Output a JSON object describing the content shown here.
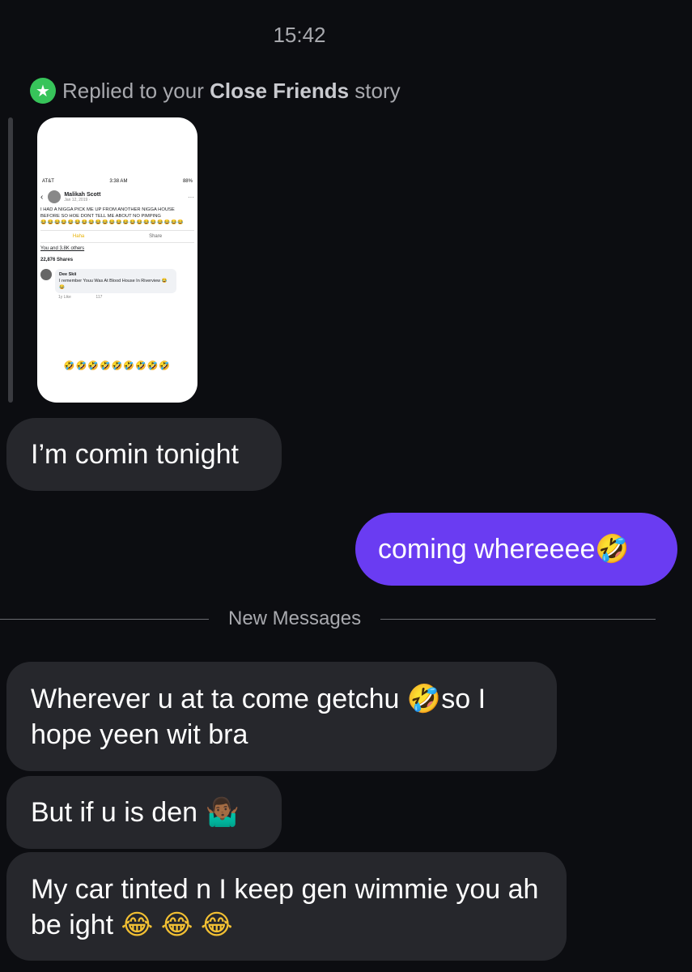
{
  "header": {
    "timestamp": "15:42"
  },
  "story_reply": {
    "prefix": "Replied to your ",
    "highlight": "Close Friends",
    "suffix": " story",
    "icon": "star-icon",
    "badge_color": "#37c45a"
  },
  "story_preview": {
    "status_carrier": "AT&T",
    "status_time": "3:38 AM",
    "status_battery": "88%",
    "author": "Malikah Scott",
    "date": "Jan 12, 2019 · ",
    "post_text": "I HAD A NIGGA PICK ME UP FROM ANOTHER NIGGA HOUSE BEFORE SO HOE DONT TELL ME ABOUT NO PIMPING",
    "post_emojis": "😂😂😂😂😂😂😂😂😂😂😂😂😂😂😂😂😂😂😂😂😂",
    "reaction_label": "Haha",
    "share_label": "Share",
    "reactions": "You and 3.8K others",
    "shares": "22,876 Shares",
    "commenter": "Dee Skii",
    "comment": "I remember Youu Was At Blood House In Riverview 😂😂",
    "comment_meta": "1y    Like",
    "comment_count": "117",
    "overlay_emojis": "🤣🤣🤣🤣🤣🤣🤣🤣🤣"
  },
  "messages": [
    {
      "side": "in",
      "text": "I’m comin tonight"
    },
    {
      "side": "out",
      "text": "coming whereeee",
      "emoji": "🤣"
    },
    {
      "side": "in",
      "text_a": "Wherever u at ta come getchu ",
      "emoji": "🤣",
      "text_b": "so I hope yeen wit bra"
    },
    {
      "side": "in",
      "text": "But if u is den ",
      "emoji": "🤷🏾‍♂️"
    },
    {
      "side": "in",
      "text": "My car tinted n I keep gen wimmie you ah be ight ",
      "emoji": "😂 😂 😂"
    }
  ],
  "divider": {
    "label": "New Messages"
  },
  "colors": {
    "background": "#0c0d11",
    "incoming": "#26272c",
    "outgoing": "#6a3cf2"
  }
}
